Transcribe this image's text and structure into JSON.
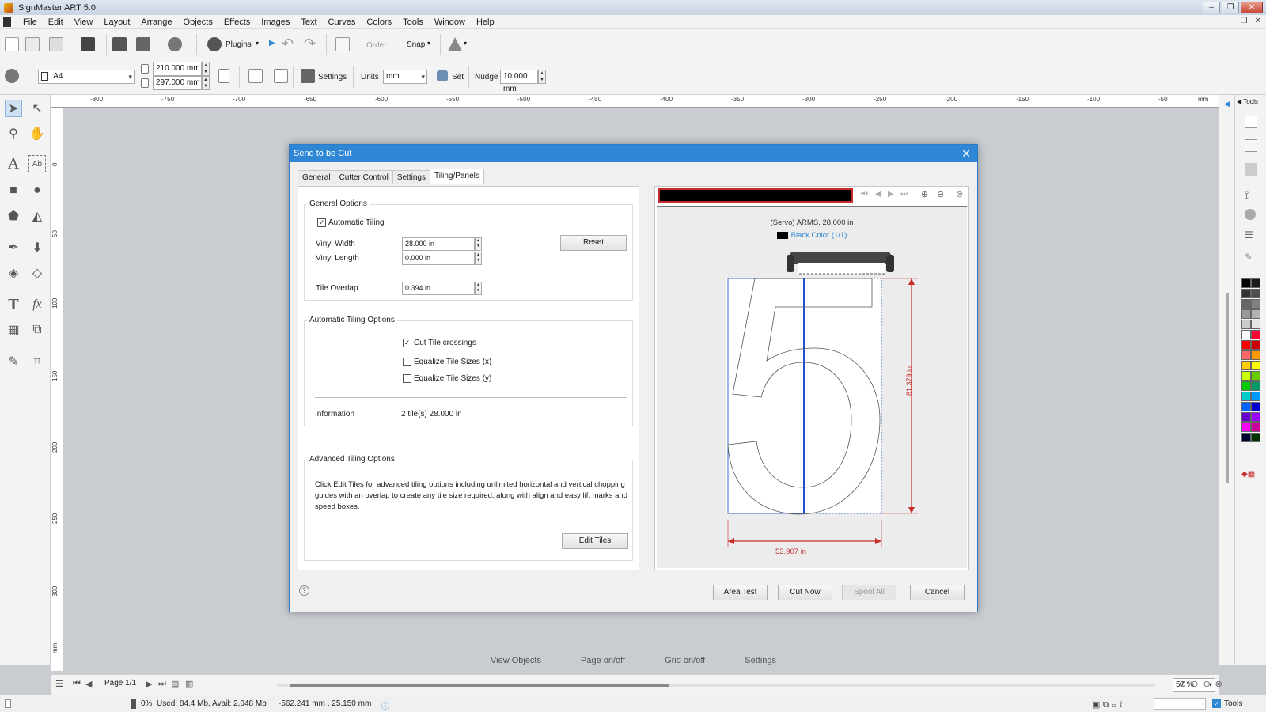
{
  "window": {
    "title": "SignMaster ART 5.0",
    "buttons": [
      "–",
      "❐",
      "✕"
    ]
  },
  "menu": [
    "File",
    "Edit",
    "View",
    "Layout",
    "Arrange",
    "Objects",
    "Effects",
    "Images",
    "Text",
    "Curves",
    "Colors",
    "Tools",
    "Window",
    "Help"
  ],
  "toolbar1": {
    "plugins_label": "Plugins",
    "order_label": "Order",
    "snap_label": "Snap"
  },
  "toolbar2": {
    "page_size": "A4",
    "width": "210.000 mm",
    "height": "297.000 mm",
    "settings_label": "Settings",
    "units_label": "Units",
    "units_value": "mm",
    "set_label": "Set",
    "nudge_label": "Nudge",
    "nudge_value": "10.000 mm"
  },
  "ruler_h": [
    "-800",
    "-750",
    "-700",
    "-650",
    "-600",
    "-550",
    "-500",
    "-450",
    "-400",
    "-350",
    "-300",
    "-250",
    "-200",
    "-150",
    "-100",
    "-50",
    "mm"
  ],
  "ruler_v": [
    "0",
    "50",
    "100",
    "150",
    "200",
    "250",
    "300",
    "mm"
  ],
  "dialog": {
    "title": "Send to be Cut",
    "tabs": [
      "General",
      "Cutter Control",
      "Settings",
      "Tiling/Panels"
    ],
    "general_options": {
      "title": "General Options",
      "automatic_tiling": "Automatic Tiling",
      "vinyl_width_label": "Vinyl Width",
      "vinyl_width": "28.000 in",
      "vinyl_length_label": "Vinyl Length",
      "vinyl_length": "0.000 in",
      "tile_overlap_label": "Tile Overlap",
      "tile_overlap": "0.394 in",
      "reset_label": "Reset"
    },
    "auto_tiling": {
      "title": "Automatic Tiling Options",
      "cut_tile_crossings": "Cut Tile crossings",
      "equalize_x": "Equalize Tile Sizes (x)",
      "equalize_y": "Equalize Tile Sizes (y)",
      "information_label": "Information",
      "information_value": "2 tile(s)  28.000 in"
    },
    "advanced": {
      "title": "Advanced Tiling Options",
      "text": "Click Edit Tiles for advanced tiling options including unlimited horizontal and vertical chopping guides with an overlap to create any tile size required, along with align and easy lift marks and speed boxes.",
      "edit_tiles_label": "Edit Tiles"
    },
    "preview": {
      "device": "(Servo) ARMS,  28.000 in",
      "color_label": "Black Color (1/1)",
      "height_dim": "81.379 in",
      "width_dim": "53.907 in"
    },
    "buttons": {
      "area_test": "Area Test",
      "cut_now": "Cut Now",
      "spool_all": "Spool All",
      "cancel": "Cancel"
    }
  },
  "bottom": {
    "view_objects": "View Objects",
    "page_onoff": "Page on/off",
    "grid_onoff": "Grid on/off",
    "settings": "Settings"
  },
  "pagebar": {
    "page": "Page 1/1",
    "zoom": "57 %"
  },
  "status": {
    "progress": "0%",
    "memory": "Used: 84.4 Mb, Avail: 2,048 Mb",
    "coords": "-562.241 mm , 25.150 mm",
    "tools": "Tools"
  },
  "right_panel": {
    "tools_tab": "Tools"
  },
  "colors": {
    "accent": "#2e86d5",
    "dimension": "#c92b2b",
    "tile_guide": "#3a6fd8",
    "palette": [
      "#000000",
      "#1a1a1a",
      "#333333",
      "#4d4d4d",
      "#666666",
      "#808080",
      "#999999",
      "#b3b3b3",
      "#cccccc",
      "#e6e6e6",
      "#ffffff",
      "#ff0033",
      "#ff0000",
      "#cc0000",
      "#ff6666",
      "#ff9900",
      "#ffcc00",
      "#ffff00",
      "#ccff00",
      "#66cc00",
      "#00cc00",
      "#009966",
      "#00cccc",
      "#0099ff",
      "#0066ff",
      "#0000cc",
      "#6600cc",
      "#9900ff",
      "#ff00ff",
      "#cc0099",
      "#000033",
      "#003300"
    ]
  }
}
